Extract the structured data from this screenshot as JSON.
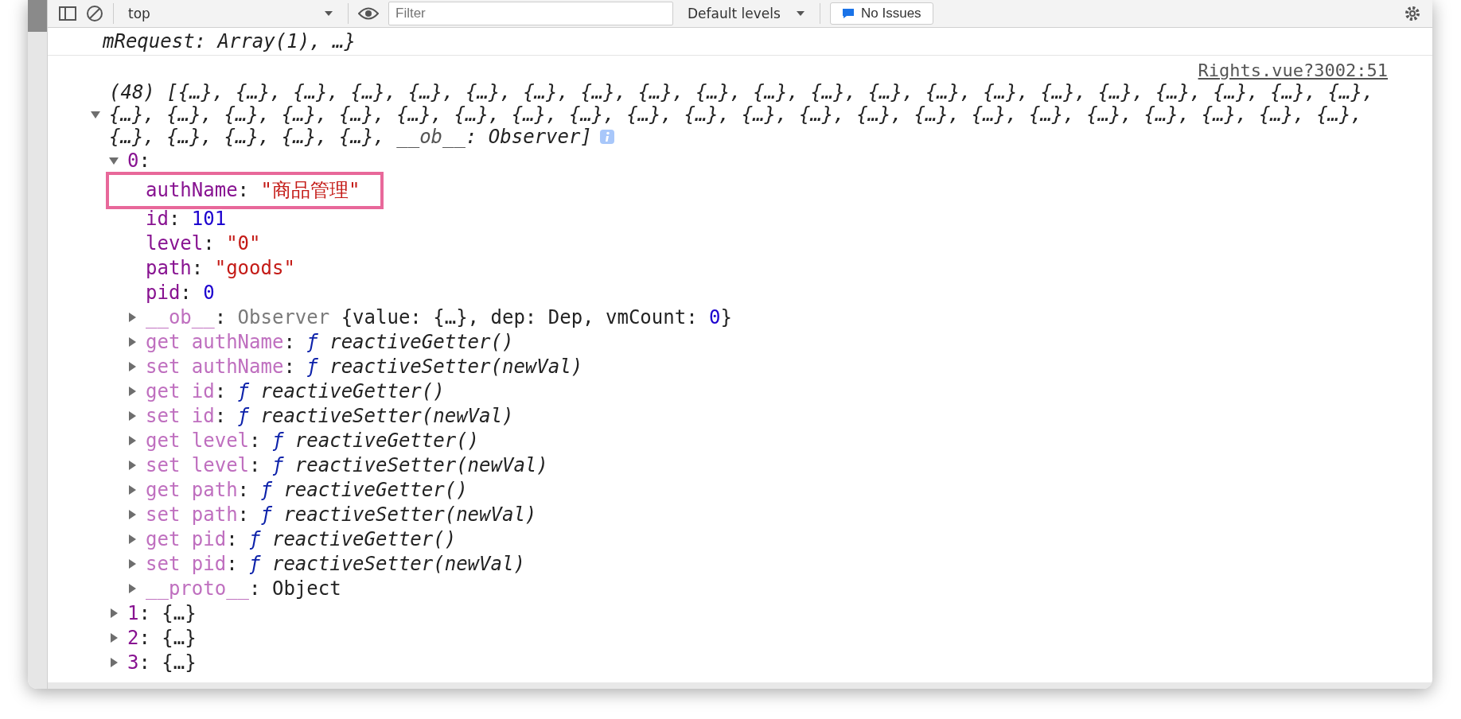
{
  "toolbar": {
    "context": "top",
    "filter_placeholder": "Filter",
    "levels": "Default levels",
    "issues": "No Issues"
  },
  "previous_message": {
    "text": "mRequest: Array(1), …}"
  },
  "source_link": "Rights.vue?3002:51",
  "array": {
    "expanded": true,
    "lines": [
      [
        {
          "text": "(48) [{…}, {…}, {…}, {…}, {…}, {…}, {…}, {…}, {…}, {…}, {…}, {…}, {…}, {…}, {…}, {…}, {…}, {…}, {…}, {…}, {…},",
          "kind": "preview"
        }
      ],
      [
        {
          "text": "{…}, {…}, {…}, {…}, {…}, {…}, {…}, {…}, {…}, {…}, {…}, {…}, {…}, {…}, {…}, {…}, {…}, {…}, {…}, {…}, {…}, {…},",
          "kind": "preview"
        }
      ],
      [
        {
          "text": "{…}, {…}, {…}, {…}, {…}, ",
          "kind": "preview"
        },
        {
          "text": "__ob__",
          "kind": "preview-dim"
        },
        {
          "text": ": Observer]",
          "kind": "preview"
        }
      ]
    ],
    "children": [
      {
        "parts": [
          {
            "text": "0",
            "kind": "key"
          },
          {
            "text": ":",
            "kind": "punct"
          }
        ],
        "expanded": true,
        "children": [
          {
            "parts": [
              {
                "text": "authName",
                "kind": "key"
              },
              {
                "text": ": ",
                "kind": "punct"
              },
              {
                "text": "\"商品管理\"",
                "kind": "string"
              }
            ],
            "highlighted": true
          },
          {
            "parts": [
              {
                "text": "id",
                "kind": "key"
              },
              {
                "text": ": ",
                "kind": "punct"
              },
              {
                "text": "101",
                "kind": "number"
              }
            ]
          },
          {
            "parts": [
              {
                "text": "level",
                "kind": "key"
              },
              {
                "text": ": ",
                "kind": "punct"
              },
              {
                "text": "\"0\"",
                "kind": "string"
              }
            ]
          },
          {
            "parts": [
              {
                "text": "path",
                "kind": "key"
              },
              {
                "text": ": ",
                "kind": "punct"
              },
              {
                "text": "\"goods\"",
                "kind": "string"
              }
            ]
          },
          {
            "parts": [
              {
                "text": "pid",
                "kind": "key"
              },
              {
                "text": ": ",
                "kind": "punct"
              },
              {
                "text": "0",
                "kind": "number"
              }
            ]
          },
          {
            "parts": [
              {
                "text": "__ob__",
                "kind": "key-dim"
              },
              {
                "text": ": ",
                "kind": "punct"
              },
              {
                "text": "Observer ",
                "kind": "class"
              },
              {
                "text": "{value: {…}, dep: Dep, vmCount: ",
                "kind": "plain"
              },
              {
                "text": "0",
                "kind": "number"
              },
              {
                "text": "}",
                "kind": "plain"
              }
            ],
            "expanded": false
          },
          {
            "parts": [
              {
                "text": "get authName",
                "kind": "key-dim"
              },
              {
                "text": ": ",
                "kind": "punct"
              },
              {
                "text": "ƒ",
                "kind": "fn-keyword"
              },
              {
                "text": " reactiveGetter()",
                "kind": "fn-name"
              }
            ],
            "expanded": false
          },
          {
            "parts": [
              {
                "text": "set authName",
                "kind": "key-dim"
              },
              {
                "text": ": ",
                "kind": "punct"
              },
              {
                "text": "ƒ",
                "kind": "fn-keyword"
              },
              {
                "text": " reactiveSetter(newVal)",
                "kind": "fn-name"
              }
            ],
            "expanded": false
          },
          {
            "parts": [
              {
                "text": "get id",
                "kind": "key-dim"
              },
              {
                "text": ": ",
                "kind": "punct"
              },
              {
                "text": "ƒ",
                "kind": "fn-keyword"
              },
              {
                "text": " reactiveGetter()",
                "kind": "fn-name"
              }
            ],
            "expanded": false
          },
          {
            "parts": [
              {
                "text": "set id",
                "kind": "key-dim"
              },
              {
                "text": ": ",
                "kind": "punct"
              },
              {
                "text": "ƒ",
                "kind": "fn-keyword"
              },
              {
                "text": " reactiveSetter(newVal)",
                "kind": "fn-name"
              }
            ],
            "expanded": false
          },
          {
            "parts": [
              {
                "text": "get level",
                "kind": "key-dim"
              },
              {
                "text": ": ",
                "kind": "punct"
              },
              {
                "text": "ƒ",
                "kind": "fn-keyword"
              },
              {
                "text": " reactiveGetter()",
                "kind": "fn-name"
              }
            ],
            "expanded": false
          },
          {
            "parts": [
              {
                "text": "set level",
                "kind": "key-dim"
              },
              {
                "text": ": ",
                "kind": "punct"
              },
              {
                "text": "ƒ",
                "kind": "fn-keyword"
              },
              {
                "text": " reactiveSetter(newVal)",
                "kind": "fn-name"
              }
            ],
            "expanded": false
          },
          {
            "parts": [
              {
                "text": "get path",
                "kind": "key-dim"
              },
              {
                "text": ": ",
                "kind": "punct"
              },
              {
                "text": "ƒ",
                "kind": "fn-keyword"
              },
              {
                "text": " reactiveGetter()",
                "kind": "fn-name"
              }
            ],
            "expanded": false
          },
          {
            "parts": [
              {
                "text": "set path",
                "kind": "key-dim"
              },
              {
                "text": ": ",
                "kind": "punct"
              },
              {
                "text": "ƒ",
                "kind": "fn-keyword"
              },
              {
                "text": " reactiveSetter(newVal)",
                "kind": "fn-name"
              }
            ],
            "expanded": false
          },
          {
            "parts": [
              {
                "text": "get pid",
                "kind": "key-dim"
              },
              {
                "text": ": ",
                "kind": "punct"
              },
              {
                "text": "ƒ",
                "kind": "fn-keyword"
              },
              {
                "text": " reactiveGetter()",
                "kind": "fn-name"
              }
            ],
            "expanded": false
          },
          {
            "parts": [
              {
                "text": "set pid",
                "kind": "key-dim"
              },
              {
                "text": ": ",
                "kind": "punct"
              },
              {
                "text": "ƒ",
                "kind": "fn-keyword"
              },
              {
                "text": " reactiveSetter(newVal)",
                "kind": "fn-name"
              }
            ],
            "expanded": false
          },
          {
            "parts": [
              {
                "text": "__proto__",
                "kind": "key-dim"
              },
              {
                "text": ": ",
                "kind": "punct"
              },
              {
                "text": "Object",
                "kind": "plain"
              }
            ],
            "expanded": false
          }
        ]
      },
      {
        "parts": [
          {
            "text": "1",
            "kind": "key"
          },
          {
            "text": ": ",
            "kind": "punct"
          },
          {
            "text": "{…}",
            "kind": "plain"
          }
        ],
        "expanded": false
      },
      {
        "parts": [
          {
            "text": "2",
            "kind": "key"
          },
          {
            "text": ": ",
            "kind": "punct"
          },
          {
            "text": "{…}",
            "kind": "plain"
          }
        ],
        "expanded": false
      },
      {
        "parts": [
          {
            "text": "3",
            "kind": "key"
          },
          {
            "text": ": ",
            "kind": "punct"
          },
          {
            "text": "{…}",
            "kind": "plain"
          }
        ],
        "expanded": false
      }
    ]
  }
}
